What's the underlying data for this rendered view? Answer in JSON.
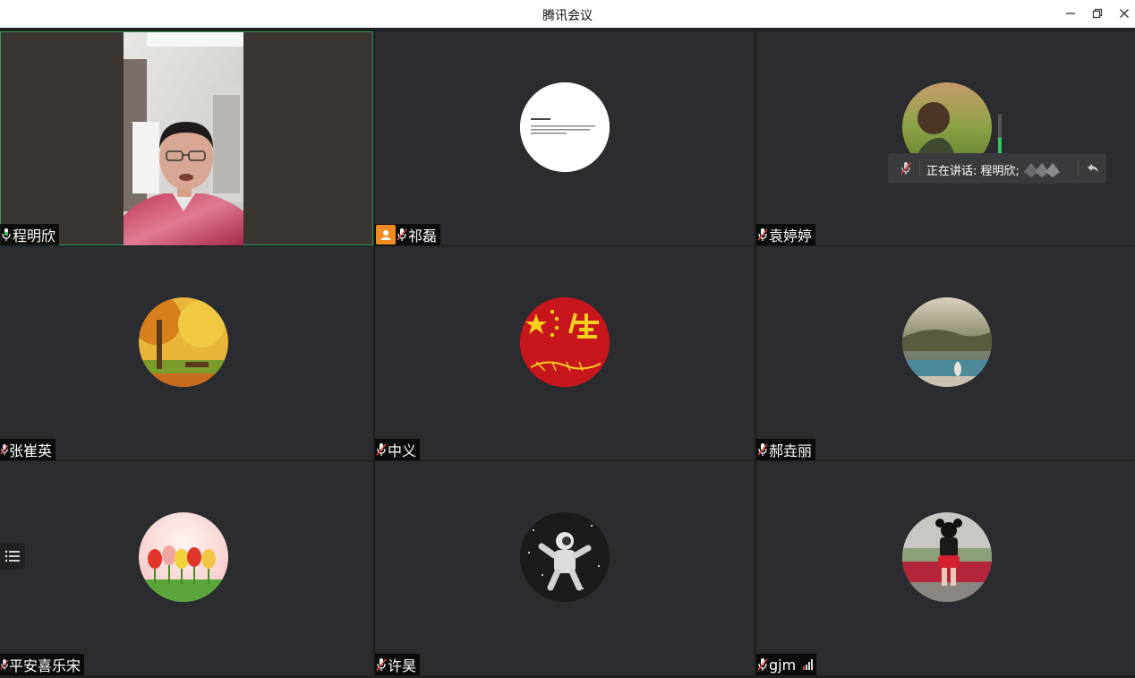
{
  "window": {
    "title": "腾讯会议"
  },
  "speaking": {
    "label": "正在讲话: 程明欣;"
  },
  "participants": [
    {
      "name": "程明欣",
      "mic": "on"
    },
    {
      "name": "祁磊",
      "mic": "muted",
      "host_badge": true
    },
    {
      "name": "袁婷婷",
      "mic": "muted"
    },
    {
      "name": "张崔英",
      "mic": "muted"
    },
    {
      "name": "中义",
      "mic": "muted"
    },
    {
      "name": "郝垚丽",
      "mic": "muted"
    },
    {
      "name": "平安喜乐宋",
      "mic": "muted"
    },
    {
      "name": "许昊",
      "mic": "muted"
    },
    {
      "name": "gjm",
      "mic": "muted",
      "signal": true
    }
  ],
  "colors": {
    "active_border": "#2c9a52",
    "tile_bg": "#2b2c2f",
    "badge_orange": "#f08a24",
    "mic_green": "#36c461",
    "mic_muted_red": "#e8453c"
  }
}
